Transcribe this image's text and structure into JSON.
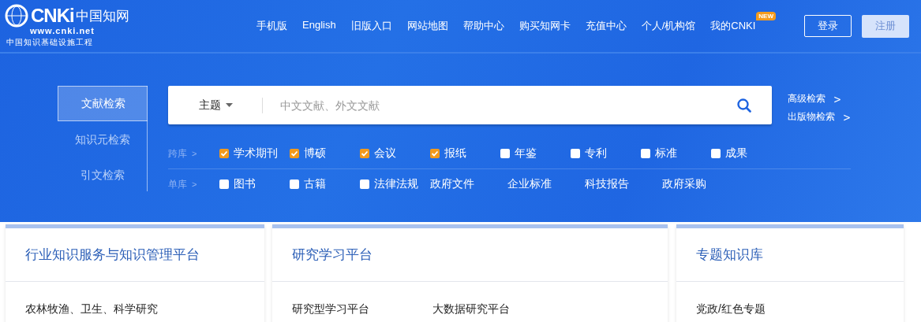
{
  "logo": {
    "brand": "CNKi",
    "brand_cn": "中国知网",
    "url": "www.cnki.net",
    "slogan": "中国知识基础设施工程"
  },
  "nav": [
    {
      "label": "手机版"
    },
    {
      "label": "English"
    },
    {
      "label": "旧版入口"
    },
    {
      "label": "网站地图"
    },
    {
      "label": "帮助中心"
    },
    {
      "label": "购买知网卡"
    },
    {
      "label": "充值中心"
    },
    {
      "label": "个人/机构馆"
    },
    {
      "label": "我的CNKI",
      "badge": "NEW"
    }
  ],
  "auth": {
    "login": "登录",
    "register": "注册"
  },
  "search_tabs": [
    {
      "label": "文献检索",
      "selected": true
    },
    {
      "label": "知识元检索",
      "selected": false
    },
    {
      "label": "引文检索",
      "selected": false
    }
  ],
  "search": {
    "field": "主题",
    "placeholder": "中文文献、外文文献"
  },
  "side_links": [
    {
      "label": "高级检索",
      "arrow": ">"
    },
    {
      "label": "出版物检索",
      "arrow": ">"
    }
  ],
  "db_rows": [
    {
      "label": "跨库",
      "arrow": ">",
      "items": [
        {
          "kind": "checkbox",
          "label": "学术期刊",
          "checked": true
        },
        {
          "kind": "checkbox",
          "label": "博硕",
          "checked": true
        },
        {
          "kind": "checkbox",
          "label": "会议",
          "checked": true
        },
        {
          "kind": "checkbox",
          "label": "报纸",
          "checked": true
        },
        {
          "kind": "checkbox",
          "label": "年鉴",
          "checked": false
        },
        {
          "kind": "checkbox",
          "label": "专利",
          "checked": false
        },
        {
          "kind": "checkbox",
          "label": "标准",
          "checked": false
        },
        {
          "kind": "checkbox",
          "label": "成果",
          "checked": false
        }
      ]
    },
    {
      "label": "单库",
      "arrow": ">",
      "items": [
        {
          "kind": "checkbox",
          "label": "图书",
          "checked": false
        },
        {
          "kind": "checkbox",
          "label": "古籍",
          "checked": false
        },
        {
          "kind": "checkbox",
          "label": "法律法规",
          "checked": false
        },
        {
          "kind": "link",
          "label": "政府文件"
        },
        {
          "kind": "link",
          "label": "企业标准"
        },
        {
          "kind": "link",
          "label": "科技报告"
        },
        {
          "kind": "link",
          "label": "政府采购"
        }
      ]
    }
  ],
  "cards": [
    {
      "title": "行业知识服务与知识管理平台",
      "items": [
        "农林牧渔、卫生、科学研究"
      ]
    },
    {
      "title": "研究学习平台",
      "items": [
        "研究型学习平台",
        "大数据研究平台"
      ]
    },
    {
      "title": "专题知识库",
      "items": [
        "党政/红色专题"
      ]
    }
  ]
}
